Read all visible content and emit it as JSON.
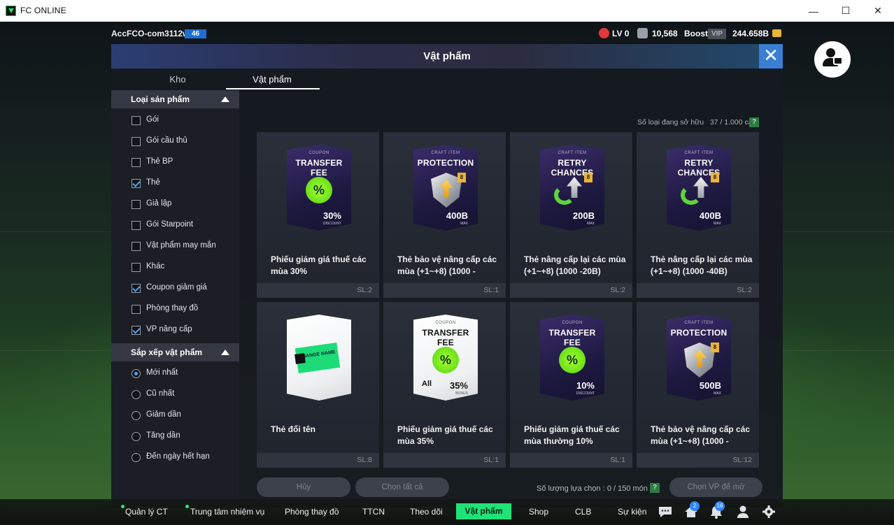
{
  "window": {
    "title": "FC ONLINE",
    "minimize": "—",
    "maximize": "☐",
    "close": "✕"
  },
  "topbar": {
    "account": "AccFCO-com3112w",
    "level_badge": "46",
    "lv": "LV 0",
    "coins": "10,568",
    "boost": "Boost",
    "vip": "VIP",
    "balance": "244.658B"
  },
  "panel": {
    "title": "Vật phẩm",
    "close": "✕",
    "tabs": [
      {
        "label": "Kho"
      },
      {
        "label": "Vật phẩm",
        "active": true
      }
    ],
    "owned_label": "Số loại đang sở hữu",
    "owned_value": "37 / 1.000 cái",
    "help": "?"
  },
  "sidebar": {
    "filter_header": "Loại sản phẩm",
    "filters": [
      {
        "label": "Gói",
        "checked": false
      },
      {
        "label": "Gói cầu thủ",
        "checked": false
      },
      {
        "label": "Thẻ BP",
        "checked": false
      },
      {
        "label": "Thẻ",
        "checked": true
      },
      {
        "label": "Giả lập",
        "checked": false
      },
      {
        "label": "Gói Starpoint",
        "checked": false
      },
      {
        "label": "Vật phẩm may mắn",
        "checked": false
      },
      {
        "label": "Khác",
        "checked": false
      },
      {
        "label": "Coupon giảm giá",
        "checked": true
      },
      {
        "label": "Phòng thay đồ",
        "checked": false
      },
      {
        "label": "VP nâng cấp",
        "checked": true
      }
    ],
    "sort_header": "Sắp xếp vật phẩm",
    "sorts": [
      {
        "label": "Mới nhất",
        "selected": true
      },
      {
        "label": "Cũ nhất",
        "selected": false
      },
      {
        "label": "Giảm dần",
        "selected": false
      },
      {
        "label": "Tăng dần",
        "selected": false
      },
      {
        "label": "Đến ngày hết hạn",
        "selected": false
      }
    ]
  },
  "items": [
    {
      "kind": "coupon",
      "style": "purple",
      "top": "COUPON",
      "head": "TRANSFER FEE",
      "value": "30%",
      "sub": "DISCOUNT",
      "icon": "%",
      "name": "Phiếu giảm giá thuế các mùa 30%",
      "qty": "SL:2"
    },
    {
      "kind": "protection",
      "style": "purple",
      "top": "CRAFT ITEM",
      "head": "PROTECTION",
      "value": "400B",
      "sub": "MAX",
      "tag": "8",
      "name": "Thẻ bảo vệ nâng cấp các mùa (+1~+8) (1000 -",
      "qty": "SL:1"
    },
    {
      "kind": "retry",
      "style": "purple",
      "top": "CRAFT ITEM",
      "head": "RETRY CHANCES",
      "value": "200B",
      "sub": "MAX",
      "tag": "8",
      "name": "Thẻ nâng cấp lại các mùa (+1~+8) (1000 -20B)",
      "qty": "SL:2"
    },
    {
      "kind": "retry",
      "style": "purple",
      "top": "CRAFT ITEM",
      "head": "RETRY CHANCES",
      "value": "400B",
      "sub": "MAX",
      "tag": "8",
      "name": "Thẻ nâng cấp lại các mùa (+1~+8) (1000 -40B)",
      "qty": "SL:2"
    },
    {
      "kind": "rename",
      "style": "white",
      "top": "",
      "head": "",
      "value": "",
      "sub": "",
      "card_text": "CHANGE NAME",
      "name": "Thẻ đổi tên",
      "qty": "SL:8"
    },
    {
      "kind": "coupon",
      "style": "white",
      "top": "COUPON",
      "head": "TRANSFER FEE",
      "value": "35%",
      "sub": "BONUS",
      "icon": "%",
      "extra": "All",
      "name": "Phiếu giảm giá thuế các mùa 35%",
      "qty": "SL:1"
    },
    {
      "kind": "coupon",
      "style": "purple",
      "top": "COUPON",
      "head": "TRANSFER FEE",
      "value": "10%",
      "sub": "DISCOUNT",
      "icon": "%",
      "name": "Phiếu giảm giá thuế các mùa thường 10%",
      "qty": "SL:1"
    },
    {
      "kind": "protection",
      "style": "purple",
      "top": "CRAFT ITEM",
      "head": "PROTECTION",
      "value": "500B",
      "sub": "MAX",
      "tag": "8",
      "name": "Thẻ bảo vệ nâng cấp các mùa (+1~+8) (1000 -",
      "qty": "SL:12"
    }
  ],
  "footer": {
    "cancel": "Hủy",
    "select_all": "Chọn tất cả",
    "selection_label": "Số lượng lựa chọn : 0 / 150 món",
    "help": "?",
    "open": "Chọn VP để mở"
  },
  "bottombar": {
    "items": [
      {
        "label": "Quản lý CT",
        "dot": true
      },
      {
        "label": "Trung tâm nhiệm vụ",
        "dot": true
      },
      {
        "label": "Phòng thay đồ"
      },
      {
        "label": "TTCN"
      },
      {
        "label": "Theo dõi"
      },
      {
        "label": "Vật phẩm",
        "active": true
      },
      {
        "label": "Shop"
      },
      {
        "label": "CLB"
      },
      {
        "label": "Sự kiện"
      }
    ],
    "badge_home": "2",
    "badge_bell": "16"
  },
  "colors": {
    "accent": "#1fe378",
    "check": "#4aa8ff",
    "close": "#3a7fd4"
  }
}
